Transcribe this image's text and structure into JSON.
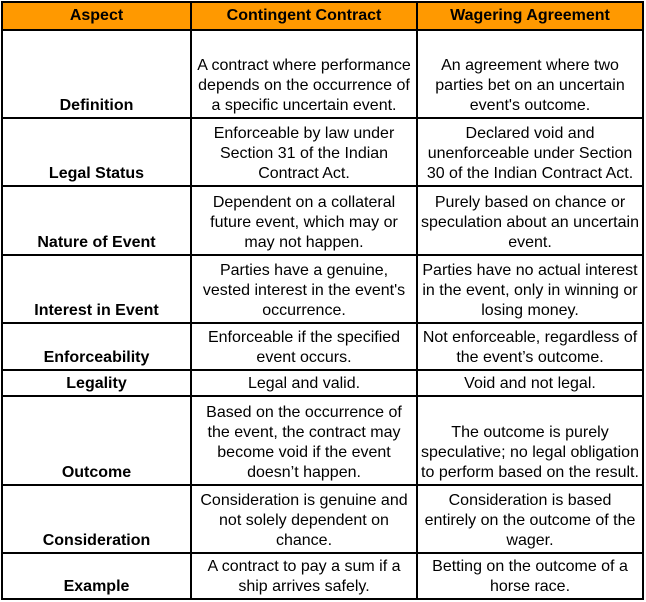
{
  "table": {
    "headers": [
      "Aspect",
      "Contingent Contract",
      "Wagering Agreement"
    ],
    "header_color": "#ff9900",
    "rows": [
      {
        "aspect": "Definition",
        "contingent": "A contract where performance depends on the occurrence of a specific uncertain event.",
        "wagering": "An agreement where two parties bet on an uncertain event's outcome."
      },
      {
        "aspect": "Legal Status",
        "contingent": "Enforceable by law under Section 31 of the Indian Contract Act.",
        "wagering": "Declared void and unenforceable under Section 30 of the Indian Contract Act."
      },
      {
        "aspect": "Nature of Event",
        "contingent": "Dependent on a collateral future event, which may or may not happen.",
        "wagering": "Purely based on chance or speculation about an uncertain event."
      },
      {
        "aspect": "Interest in Event",
        "contingent": "Parties have a genuine, vested interest in the event's occurrence.",
        "wagering": "Parties have no actual interest in the event, only in winning or losing money."
      },
      {
        "aspect": "Enforceability",
        "contingent": "Enforceable if the specified event occurs.",
        "wagering": "Not enforceable, regardless of the event’s outcome."
      },
      {
        "aspect": "Legality",
        "contingent": "Legal and valid.",
        "wagering": "Void and not legal."
      },
      {
        "aspect": "Outcome",
        "contingent": "Based on the occurrence of the event, the contract may become void if the event doesn’t happen.",
        "wagering": "The outcome is purely speculative; no legal obligation to perform based on the result."
      },
      {
        "aspect": "Consideration",
        "contingent": "Consideration is genuine and not solely dependent on chance.",
        "wagering": "Consideration is based entirely on the outcome of the wager."
      },
      {
        "aspect": "Example",
        "contingent": "A contract to pay a sum if a ship arrives safely.",
        "wagering": "Betting on the outcome of a horse race."
      }
    ]
  }
}
